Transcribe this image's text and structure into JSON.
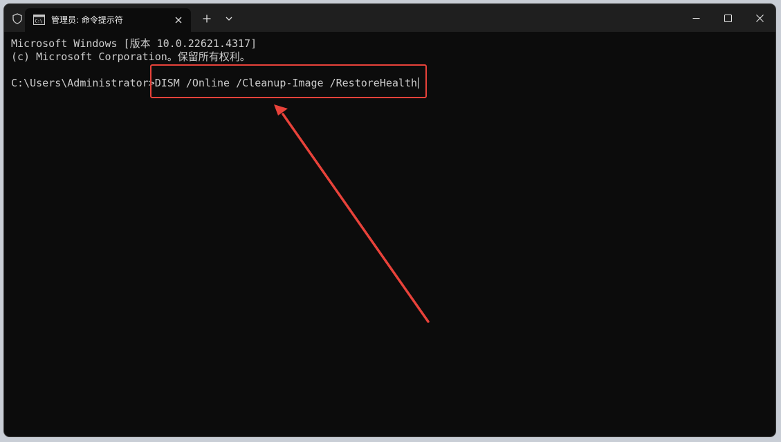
{
  "window": {
    "tab_title": "管理员: 命令提示符",
    "icons": {
      "shield": "shield-icon",
      "tab": "cmd-icon",
      "tab_close": "close-icon",
      "new_tab": "plus-icon",
      "dropdown": "chevron-down-icon",
      "minimize": "minimize-icon",
      "maximize": "maximize-icon",
      "close": "close-icon"
    }
  },
  "terminal": {
    "line1": "Microsoft Windows [版本 10.0.22621.4317]",
    "line2": "(c) Microsoft Corporation。保留所有权利。",
    "prompt": "C:\\Users\\Administrator>",
    "command": "DISM /Online /Cleanup-Image /RestoreHealth"
  },
  "colors": {
    "background": "#0c0c0c",
    "titlebar": "#1f1f1f",
    "text": "#cccccc",
    "annotation": "#e8423a"
  }
}
